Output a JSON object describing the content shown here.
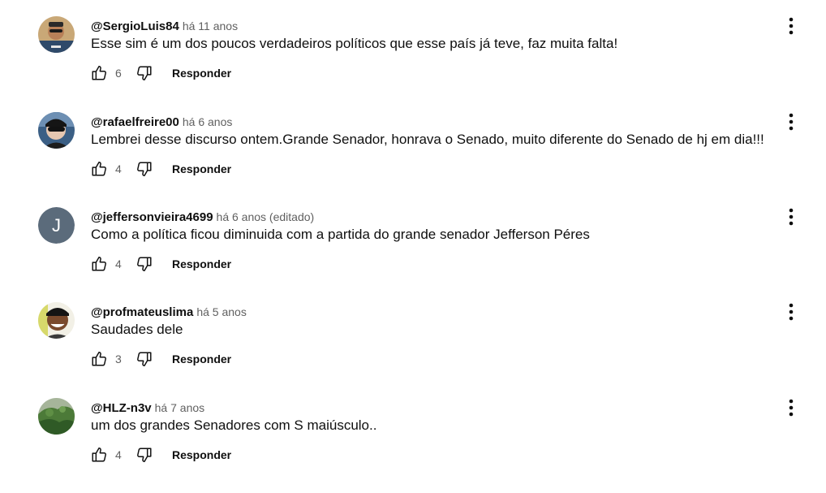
{
  "reply_label": "Responder",
  "colors": {
    "text": "#0f0f0f",
    "secondary": "#606060",
    "letter_avatar_bg": "#5b6b7b"
  },
  "comments": [
    {
      "handle": "@SergioLuis84",
      "time": "há 11 anos",
      "text": "Esse sim é um dos poucos verdadeiros políticos que esse país já teve, faz muita falta!",
      "likes": "6",
      "avatar": "photo-avatar"
    },
    {
      "handle": "@rafaelfreire00",
      "time": "há 6 anos",
      "text": "Lembrei desse discurso ontem.Grande Senador, honrava o Senado, muito diferente do Senado de hj em dia!!!",
      "likes": "4",
      "avatar": "photo-avatar"
    },
    {
      "handle": "@jeffersonvieira4699",
      "time": "há 6 anos (editado)",
      "text": "Como a política ficou diminuida com a partida do grande senador Jefferson Péres",
      "likes": "4",
      "avatar_letter": "J"
    },
    {
      "handle": "@profmateuslima",
      "time": "há 5 anos",
      "text": "Saudades dele",
      "likes": "3",
      "avatar": "photo-avatar"
    },
    {
      "handle": "@HLZ-n3v",
      "time": "há 7 anos",
      "text": "um dos grandes Senadores com S maiúsculo..",
      "likes": "4",
      "avatar": "photo-avatar"
    }
  ]
}
